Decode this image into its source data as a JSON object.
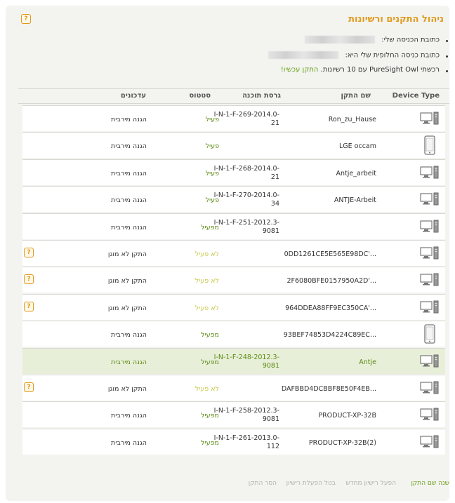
{
  "title": "ניהול התקנים ורשיונות",
  "info": {
    "login_label": "כתובת הכניסה שלי:",
    "alt_login_label": "כתובת כניסה החלופית שלי היא:",
    "license_text": "רכשתי PureSight Owl עם 10 רשיונות.",
    "install_now": "התקן עכשיו!"
  },
  "table": {
    "headers": {
      "device_type": "Device Type",
      "name": "שם התקן",
      "version": "גרסת תוכנה",
      "status": "סטטוס",
      "updates": "עדכונים"
    },
    "rows": [
      {
        "icon": "desktop-icon",
        "name": "Ron_zu_Hause",
        "version": "I-N-1-F-269-2014.0-21",
        "status": "פעיל",
        "updates": "הגנה מירבית",
        "help": false,
        "highlight": false
      },
      {
        "icon": "phone-icon",
        "name": "LGE occam",
        "version": "",
        "status": "פעיל",
        "updates": "הגנה מירבית",
        "help": false,
        "highlight": false
      },
      {
        "icon": "desktop-icon",
        "name": "Antje_arbeit",
        "version": "I-N-1-F-268-2014.0-21",
        "status": "פעיל",
        "updates": "הגנה מירבית",
        "help": false,
        "highlight": false
      },
      {
        "icon": "desktop-icon",
        "name": "ANTJE-Arbeit",
        "version": "I-N-1-F-270-2014.0-34",
        "status": "פעיל",
        "updates": "הגנה מירבית",
        "help": false,
        "highlight": false
      },
      {
        "icon": "desktop-icon",
        "name": "",
        "version": "I-N-1-F-251-2012.3-9081",
        "status": "מפעיל",
        "updates": "הגנה מירבית",
        "help": false,
        "highlight": false
      },
      {
        "icon": "desktop-icon",
        "name": "0DD1261CE5E565E98DC'...",
        "version": "",
        "status": "לא פעיל",
        "updates": "התקן לא מוגן",
        "help": true,
        "highlight": false
      },
      {
        "icon": "desktop-icon",
        "name": "2F6080BFE0157950A2D'...",
        "version": "",
        "status": "לא פעיל",
        "updates": "התקן לא מוגן",
        "help": true,
        "highlight": false
      },
      {
        "icon": "desktop-icon",
        "name": "964DDEA88FF9EC350CA'...",
        "version": "",
        "status": "לא פעיל",
        "updates": "התקן לא מוגן",
        "help": true,
        "highlight": false
      },
      {
        "icon": "phone-icon",
        "name": "93BEF74853D4224C89EC...",
        "version": "",
        "status": "מפעיל",
        "updates": "הגנה מירבית",
        "help": false,
        "highlight": false
      },
      {
        "icon": "desktop-icon",
        "name": "Antje",
        "version": "I-N-1-F-248-2012.3-9081",
        "status": "מפעיל",
        "updates": "הגנה מירבית",
        "help": false,
        "highlight": true
      },
      {
        "icon": "desktop-icon",
        "name": "DAFBBD4DCBBF8E50F4EB...",
        "version": "",
        "status": "לא פעיל",
        "updates": "התקן לא מוגן",
        "help": true,
        "highlight": false
      },
      {
        "icon": "desktop-icon",
        "name": "PRODUCT-XP-32B",
        "version": "I-N-1-F-258-2012.3-9081",
        "status": "מפעיל",
        "updates": "הגנה מירבית",
        "help": false,
        "highlight": false
      },
      {
        "icon": "desktop-icon",
        "name": "PRODUCT-XP-32B(2)",
        "version": "I-N-1-F-261-2013.0-112",
        "status": "מפעיל",
        "updates": "הגנה מירבית",
        "help": false,
        "highlight": false
      }
    ]
  },
  "footer": {
    "rename": "שנה שם התקן",
    "reactivate": "הפעל רישיון מחדש",
    "deactivate": "בטל הפעלת רישיון",
    "remove": "הסר התקן"
  },
  "colors": {
    "accent": "#e09a1a",
    "green": "#6aa11a",
    "inactive": "#c8c848",
    "highlight_row": "#e8efd9"
  }
}
